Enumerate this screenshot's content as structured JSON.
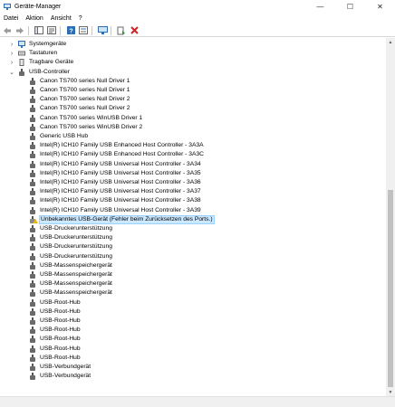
{
  "window": {
    "title": "Geräte-Manager",
    "minimize_glyph": "—",
    "maximize_glyph": "☐",
    "close_glyph": "✕"
  },
  "menu": [
    "Datei",
    "Aktion",
    "Ansicht",
    "?"
  ],
  "toolbar": {
    "buttons": [
      "back-arrow-icon",
      "forward-arrow-icon",
      "show-hide-console-tree-icon",
      "properties-icon",
      "help-icon",
      "properties-sheet-icon",
      "monitor-scan-icon",
      "update-driver-icon",
      "uninstall-device-icon"
    ]
  },
  "tree": {
    "categories": [
      {
        "label": "Systemgeräte",
        "expander": ">"
      },
      {
        "label": "Tastaturen",
        "expander": ">"
      },
      {
        "label": "Tragbare Geräte",
        "expander": ">"
      },
      {
        "label": "USB-Controller",
        "expander": "v"
      }
    ],
    "usb_devices": [
      "Canon TS700 series Null Driver 1",
      "Canon TS700 series Null Driver 1",
      "Canon TS700 series Null Driver 2",
      "Canon TS700 series Null Driver 2",
      "Canon TS700 series WinUSB Driver 1",
      "Canon TS700 series WinUSB Driver 2",
      "Generic USB Hub",
      "Intel(R) ICH10 Family USB Enhanced Host Controller - 3A3A",
      "Intel(R) ICH10 Family USB Enhanced Host Controller - 3A3C",
      "Intel(R) ICH10 Family USB Universal Host Controller - 3A34",
      "Intel(R) ICH10 Family USB Universal Host Controller - 3A35",
      "Intel(R) ICH10 Family USB Universal Host Controller - 3A36",
      "Intel(R) ICH10 Family USB Universal Host Controller - 3A37",
      "Intel(R) ICH10 Family USB Universal Host Controller - 3A38",
      "Intel(R) ICH10 Family USB Universal Host Controller - 3A39",
      "Unbekanntes USB-Gerät (Fehler beim Zurücksetzen des Ports.)",
      "USB-Druckerunterstützung",
      "USB-Druckerunterstützung",
      "USB-Druckerunterstützung",
      "USB-Druckerunterstützung",
      "USB-Massenspeichergerät",
      "USB-Massenspeichergerät",
      "USB-Massenspeichergerät",
      "USB-Massenspeichergerät",
      "USB-Root-Hub",
      "USB-Root-Hub",
      "USB-Root-Hub",
      "USB-Root-Hub",
      "USB-Root-Hub",
      "USB-Root-Hub",
      "USB-Root-Hub",
      "USB-Verbundgerät",
      "USB-Verbundgerät"
    ],
    "selected_device": "Unbekanntes USB-Gerät (Fehler beim Zurücksetzen des Ports.)"
  },
  "colors": {
    "selection_bg": "#cce8ff",
    "selection_border": "#99d1ff",
    "warning": "#e8b40c",
    "uninstall_red": "#d32020"
  }
}
